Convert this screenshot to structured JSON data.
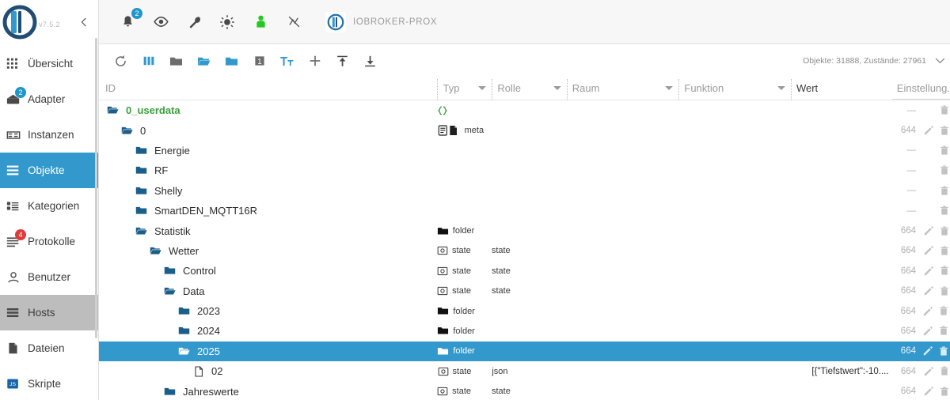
{
  "sidebar": {
    "version": "v7.5.2",
    "collapse_icon": "chevron-left-icon",
    "items": [
      {
        "label": "Übersicht",
        "icon": "grid-icon",
        "badge": "",
        "state": "normal"
      },
      {
        "label": "Adapter",
        "icon": "adapter-icon",
        "badge": "2",
        "badge_color": "#2196c9",
        "state": "normal"
      },
      {
        "label": "Instanzen",
        "icon": "instances-icon",
        "badge": "",
        "state": "normal"
      },
      {
        "label": "Objekte",
        "icon": "objects-icon",
        "badge": "",
        "state": "selected"
      },
      {
        "label": "Kategorien",
        "icon": "categories-icon",
        "badge": "",
        "state": "normal"
      },
      {
        "label": "Protokolle",
        "icon": "logs-icon",
        "badge": "4",
        "badge_color": "#e03b3b",
        "state": "normal"
      },
      {
        "label": "Benutzer",
        "icon": "user-icon",
        "badge": "",
        "state": "normal"
      },
      {
        "label": "Hosts",
        "icon": "hosts-icon",
        "badge": "",
        "state": "hovered"
      },
      {
        "label": "Dateien",
        "icon": "files-icon",
        "badge": "",
        "state": "normal"
      },
      {
        "label": "Skripte",
        "icon": "scripts-icon",
        "badge": "",
        "state": "normal"
      }
    ]
  },
  "topbar": {
    "icons": [
      {
        "name": "bell-icon",
        "badge": "2"
      },
      {
        "name": "eye-icon",
        "badge": ""
      },
      {
        "name": "wrench-icon",
        "badge": ""
      },
      {
        "name": "brightness-icon",
        "badge": ""
      },
      {
        "name": "person-green-icon",
        "badge": ""
      },
      {
        "name": "no-connection-icon",
        "badge": ""
      }
    ],
    "host_name": "IOBROKER-PROX",
    "host_logo_icon": "iobroker-logo-icon"
  },
  "objbar": {
    "icons": [
      {
        "name": "refresh-icon",
        "color": "gray"
      },
      {
        "name": "columns-icon",
        "color": "blue"
      },
      {
        "name": "folder-closed-icon",
        "color": "gray"
      },
      {
        "name": "folder-open-icon",
        "color": "blue"
      },
      {
        "name": "folder-icon",
        "color": "blue"
      },
      {
        "name": "depth-one-icon",
        "color": "gray"
      },
      {
        "name": "text-size-icon",
        "color": "blue"
      },
      {
        "name": "add-icon",
        "color": "gray"
      },
      {
        "name": "import-icon",
        "color": "gray"
      },
      {
        "name": "export-icon",
        "color": "gray"
      }
    ],
    "counts_text": "Objekte: 31888, Zustände: 27961",
    "counts_icon": "expand-icon"
  },
  "table": {
    "columns": {
      "id": "ID",
      "typ": "Typ",
      "rolle": "Rolle",
      "raum": "Raum",
      "funktion": "Funktion",
      "wert": "Wert",
      "einstellungen": "Einstellung."
    },
    "rows": [
      {
        "name": "0_userdata",
        "depth": 0,
        "icon": "folder-open-icon",
        "name_color": "green",
        "type_icon": "json-braces-icon",
        "type_label": "",
        "role": "",
        "raum": "",
        "funktion": "",
        "wert": "",
        "perm": "—",
        "has_edit": false,
        "selected": false
      },
      {
        "name": "0",
        "depth": 1,
        "icon": "folder-open-icon",
        "name_color": "normal",
        "type_icon": "meta-doc-icon",
        "type_label": "meta",
        "role": "",
        "raum": "",
        "funktion": "",
        "wert": "",
        "perm": "644",
        "has_edit": true,
        "selected": false
      },
      {
        "name": "Energie",
        "depth": 2,
        "icon": "folder-closed-icon",
        "name_color": "normal",
        "type_icon": "",
        "type_label": "",
        "role": "",
        "raum": "",
        "funktion": "",
        "wert": "",
        "perm": "—",
        "has_edit": false,
        "selected": false
      },
      {
        "name": "RF",
        "depth": 2,
        "icon": "folder-closed-icon",
        "name_color": "normal",
        "type_icon": "",
        "type_label": "",
        "role": "",
        "raum": "",
        "funktion": "",
        "wert": "",
        "perm": "—",
        "has_edit": false,
        "selected": false
      },
      {
        "name": "Shelly",
        "depth": 2,
        "icon": "folder-closed-icon",
        "name_color": "normal",
        "type_icon": "",
        "type_label": "",
        "role": "",
        "raum": "",
        "funktion": "",
        "wert": "",
        "perm": "—",
        "has_edit": false,
        "selected": false
      },
      {
        "name": "SmartDEN_MQTT16R",
        "depth": 2,
        "icon": "folder-closed-icon",
        "name_color": "normal",
        "type_icon": "",
        "type_label": "",
        "role": "",
        "raum": "",
        "funktion": "",
        "wert": "",
        "perm": "—",
        "has_edit": false,
        "selected": false
      },
      {
        "name": "Statistik",
        "depth": 2,
        "icon": "folder-open-icon",
        "name_color": "normal",
        "type_icon": "folder-type-icon",
        "type_label": "folder",
        "role": "",
        "raum": "",
        "funktion": "",
        "wert": "",
        "perm": "664",
        "has_edit": true,
        "selected": false
      },
      {
        "name": "Wetter",
        "depth": 3,
        "icon": "folder-open-icon",
        "name_color": "normal",
        "type_icon": "state-type-icon",
        "type_label": "state",
        "role": "state",
        "raum": "",
        "funktion": "",
        "wert": "",
        "perm": "664",
        "has_edit": true,
        "selected": false
      },
      {
        "name": "Control",
        "depth": 4,
        "icon": "folder-closed-icon",
        "name_color": "normal",
        "type_icon": "state-type-icon",
        "type_label": "state",
        "role": "state",
        "raum": "",
        "funktion": "",
        "wert": "",
        "perm": "664",
        "has_edit": true,
        "selected": false
      },
      {
        "name": "Data",
        "depth": 4,
        "icon": "folder-open-icon",
        "name_color": "normal",
        "type_icon": "state-type-icon",
        "type_label": "state",
        "role": "state",
        "raum": "",
        "funktion": "",
        "wert": "",
        "perm": "664",
        "has_edit": true,
        "selected": false
      },
      {
        "name": "2023",
        "depth": 5,
        "icon": "folder-closed-icon",
        "name_color": "normal",
        "type_icon": "folder-type-icon",
        "type_label": "folder",
        "role": "",
        "raum": "",
        "funktion": "",
        "wert": "",
        "perm": "664",
        "has_edit": true,
        "selected": false
      },
      {
        "name": "2024",
        "depth": 5,
        "icon": "folder-closed-icon",
        "name_color": "normal",
        "type_icon": "folder-type-icon",
        "type_label": "folder",
        "role": "",
        "raum": "",
        "funktion": "",
        "wert": "",
        "perm": "664",
        "has_edit": true,
        "selected": false
      },
      {
        "name": "2025",
        "depth": 5,
        "icon": "folder-open-icon",
        "name_color": "normal",
        "type_icon": "folder-type-icon",
        "type_label": "folder",
        "role": "",
        "raum": "",
        "funktion": "",
        "wert": "",
        "perm": "664",
        "has_edit": true,
        "selected": true
      },
      {
        "name": "02",
        "depth": 6,
        "icon": "file-icon",
        "name_color": "normal",
        "type_icon": "state-type-icon",
        "type_label": "state",
        "role": "json",
        "raum": "",
        "funktion": "",
        "wert": "[{\"Tiefstwert\":-10....",
        "perm": "664",
        "has_edit": true,
        "selected": false
      },
      {
        "name": "Jahreswerte",
        "depth": 4,
        "icon": "folder-closed-icon",
        "name_color": "normal",
        "type_icon": "state-type-icon",
        "type_label": "state",
        "role": "state",
        "raum": "",
        "funktion": "",
        "wert": "",
        "perm": "664",
        "has_edit": true,
        "selected": false
      }
    ]
  },
  "colors": {
    "accent": "#3399cc",
    "green": "#3aa03a",
    "folder_blue": "#1b5e8a",
    "badge_blue": "#2196c9",
    "badge_red": "#e03b3b"
  }
}
